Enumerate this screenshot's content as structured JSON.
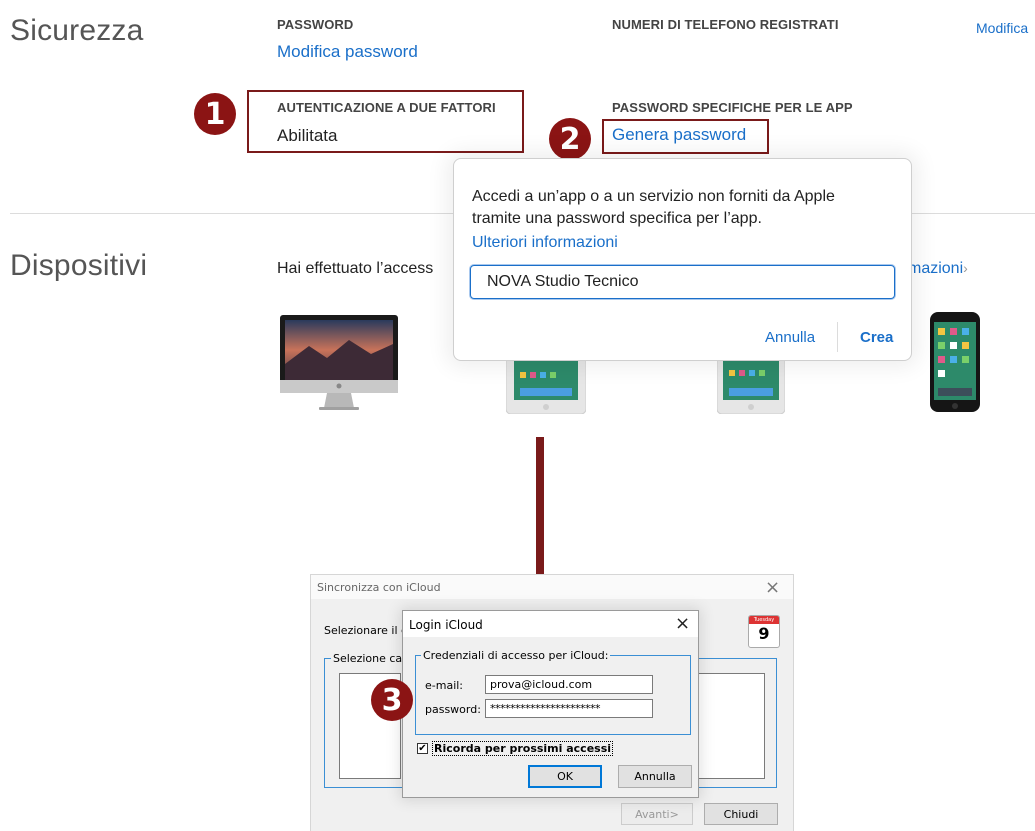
{
  "security": {
    "title": "Sicurezza",
    "password_header": "PASSWORD",
    "password_link": "Modifica password",
    "phones_header": "NUMERI DI TELEFONO REGISTRATI",
    "edit_link": "Modifica",
    "twofa_header": "AUTENTICAZIONE A DUE FATTORI",
    "twofa_value": "Abilitata",
    "apppw_header": "PASSWORD SPECIFICHE PER LE APP",
    "apppw_link": "Genera password"
  },
  "badges": {
    "one": "1",
    "two": "2",
    "three": "3"
  },
  "popover": {
    "line1": "Accedi a un’app o a un servizio non forniti da Apple",
    "line2": "tramite una password specifica per l’app.",
    "more_link": "Ulteriori informazioni",
    "input_value": "NOVA Studio Tecnico",
    "cancel": "Annulla",
    "create": "Crea"
  },
  "devices": {
    "title": "Dispositivi",
    "text": "Hai effettuato l’access",
    "more_link": "mazioni",
    "chevron": "›"
  },
  "sync_window": {
    "title": "Sincronizza con iCloud",
    "close": "×",
    "select_text": "Selezionare il ca",
    "group_label": "Selezione cal",
    "calendar_day": "9",
    "calendar_month": "Tuesday",
    "next_button": "Avanti>",
    "close_button": "Chiudi"
  },
  "login_dialog": {
    "title": "Login iCloud",
    "close": "×",
    "group_label": "Credenziali di accesso per iCloud:",
    "email_label": "e-mail:",
    "email_value": "prova@icloud.com",
    "password_label": "password:",
    "password_value": "**********************",
    "remember_label": "Ricorda per prossimi accessi",
    "remember_checked": true,
    "ok": "OK",
    "cancel": "Annulla"
  },
  "colors": {
    "accent": "#1a6fc9",
    "badge": "#8b1414",
    "arrow": "#7a1a1a"
  }
}
